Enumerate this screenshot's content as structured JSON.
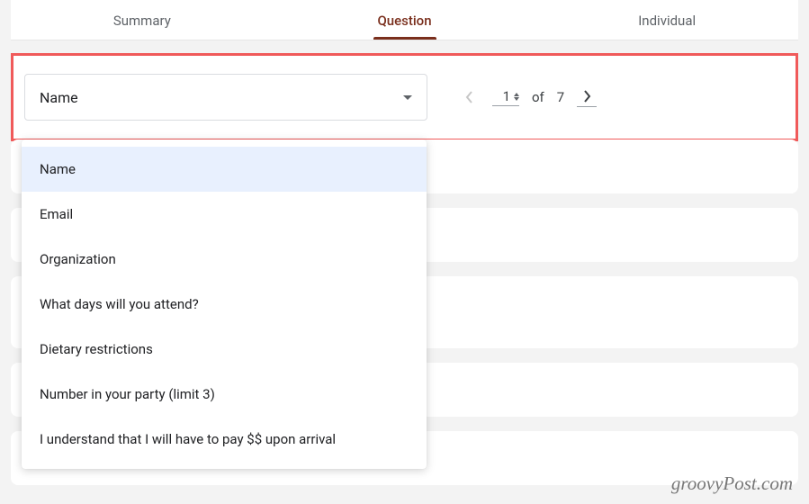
{
  "tabs": {
    "summary": "Summary",
    "question": "Question",
    "individual": "Individual"
  },
  "selector": {
    "selected": "Name",
    "options": [
      "Name",
      "Email",
      "Organization",
      "What days will you attend?",
      "Dietary restrictions",
      "Number in your party (limit 3)",
      "I understand that I will have to pay $$ upon arrival"
    ]
  },
  "pager": {
    "current": "1",
    "of_label": "of",
    "total": "7"
  },
  "watermark": "groovyPost.com"
}
